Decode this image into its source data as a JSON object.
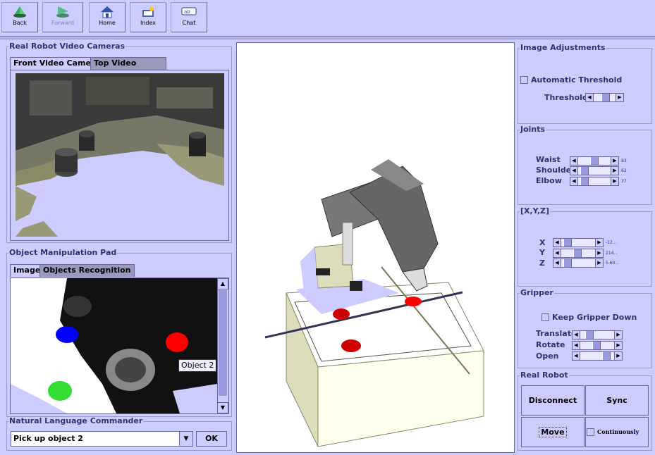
{
  "toolbar": {
    "buttons": [
      {
        "label": "Back",
        "icon": "back-arrow-icon",
        "enabled": true
      },
      {
        "label": "Forward",
        "icon": "forward-arrow-icon",
        "enabled": false
      },
      {
        "label": "Home",
        "icon": "home-icon",
        "enabled": true
      },
      {
        "label": "Index",
        "icon": "index-icon",
        "enabled": true
      },
      {
        "label": "Chat",
        "icon": "chat-icon",
        "enabled": true
      }
    ]
  },
  "cameras": {
    "title": "Real Robot Video Cameras",
    "tabs": [
      "Front Video Camera",
      "Top Video Camera"
    ],
    "active_tab": "Front Video Camera"
  },
  "pad": {
    "title": "Object Manipulation Pad",
    "tabs": [
      "Image",
      "Objects Recognition"
    ],
    "active_tab": "Image",
    "tooltip": "Object 2"
  },
  "commander": {
    "title": "Natural Language Commander",
    "value": "Pick up object 2",
    "ok_label": "OK"
  },
  "image_adjustments": {
    "title": "Image Adjustments",
    "auto_threshold_label": "Automatic Threshold",
    "auto_threshold_checked": false,
    "threshold_label": "Threshold"
  },
  "joints": {
    "title": "Joints",
    "sliders": [
      {
        "label": "Waist",
        "value": "93"
      },
      {
        "label": "Shoulder",
        "value": "62"
      },
      {
        "label": "Elbow",
        "value": "37"
      }
    ]
  },
  "xyz": {
    "title": "[X,Y,Z]",
    "sliders": [
      {
        "label": "X",
        "value": "-12..."
      },
      {
        "label": "Y",
        "value": "214..."
      },
      {
        "label": "Z",
        "value": "5.60..."
      }
    ]
  },
  "gripper": {
    "title": "Gripper",
    "keep_down_label": "Keep Gripper Down",
    "keep_down_checked": false,
    "sliders": [
      {
        "label": "Translate"
      },
      {
        "label": "Rotate"
      },
      {
        "label": "Open"
      }
    ]
  },
  "real_robot": {
    "title": "Real Robot",
    "disconnect_label": "Disconnect",
    "sync_label": "Sync",
    "move_label": "Move",
    "continuously_label": "Continuously",
    "continuously_checked": false
  },
  "colors": {
    "background": "#ccccff",
    "object_red": "#ff0000",
    "object_blue": "#0000ff",
    "object_green": "#33dd33"
  }
}
